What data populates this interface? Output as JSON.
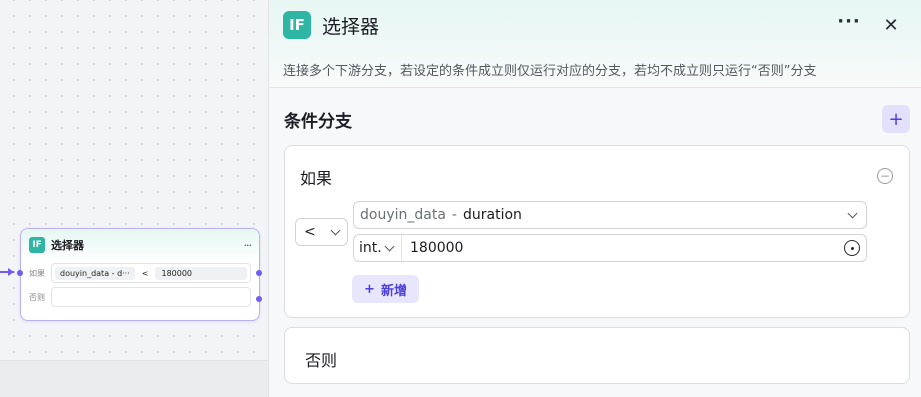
{
  "canvas": {
    "node": {
      "icon_text": "IF",
      "title": "选择器",
      "more": "···",
      "if_label": "如果",
      "variable_chip": "douyin_data - d···",
      "operator": "<",
      "value": "180000",
      "else_label": "否则"
    }
  },
  "panel": {
    "icon_text": "IF",
    "title": "选择器",
    "more": "···",
    "close": "✕",
    "description": "连接多个下游分支，若设定的条件成立则仅运行对应的分支，若均不成立则只运行“否则”分支",
    "section_title": "条件分支",
    "add_branch": "+",
    "if_branch": {
      "label": "如果",
      "remove": "−",
      "operator": "<",
      "variable": {
        "node": "douyin_data",
        "separator": "-",
        "field": "duration"
      },
      "value_type": "int.",
      "value": "180000",
      "add_condition_label": "新增",
      "add_condition_icon": "+"
    },
    "else_branch": {
      "label": "否则"
    }
  },
  "colors": {
    "accent": "#4c3fe0",
    "node_border": "#b9b1f6",
    "if_icon": "#2fb5a4"
  }
}
